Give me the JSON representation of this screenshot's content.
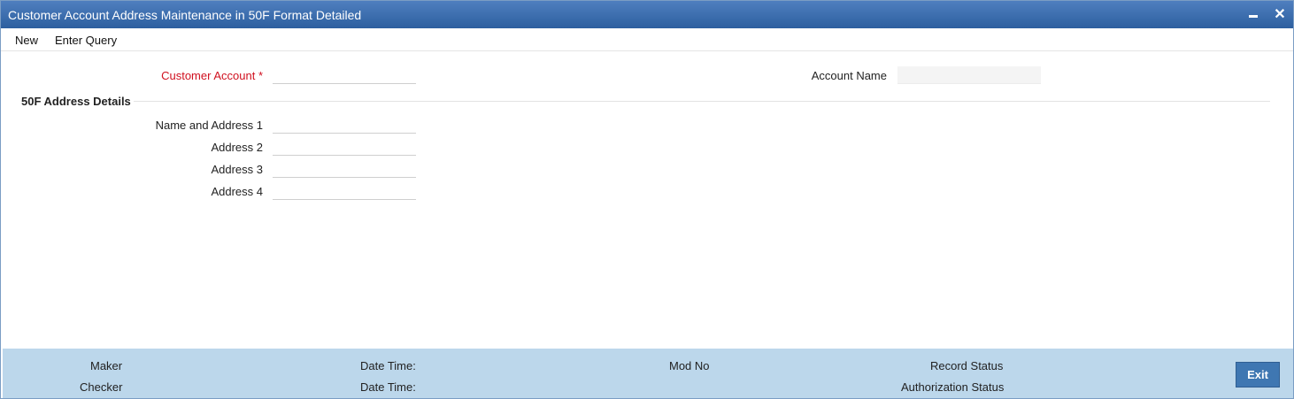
{
  "window": {
    "title": "Customer Account Address Maintenance in 50F Format Detailed",
    "minimize_icon": "minimize-icon",
    "close_icon": "close-icon",
    "close_glyph": "✕"
  },
  "menu": {
    "new_label": "New",
    "enter_query_label": "Enter Query"
  },
  "form": {
    "customer_account_label": "Customer Account",
    "required_marker": "*",
    "customer_account_value": "",
    "account_name_label": "Account Name",
    "account_name_value": "",
    "section_title": "50F Address Details",
    "name_address1_label": "Name and Address 1",
    "name_address1_value": "",
    "address2_label": "Address 2",
    "address2_value": "",
    "address3_label": "Address 3",
    "address3_value": "",
    "address4_label": "Address 4",
    "address4_value": ""
  },
  "footer": {
    "maker_label": "Maker",
    "checker_label": "Checker",
    "date_time1_label": "Date Time:",
    "date_time2_label": "Date Time:",
    "mod_no_label": "Mod No",
    "record_status_label": "Record Status",
    "authorization_status_label": "Authorization Status",
    "exit_label": "Exit"
  },
  "colors": {
    "titlebar": "#3a6aad",
    "required": "#d0101f",
    "footer": "#bcd7eb",
    "exit_button": "#3f77b2"
  }
}
